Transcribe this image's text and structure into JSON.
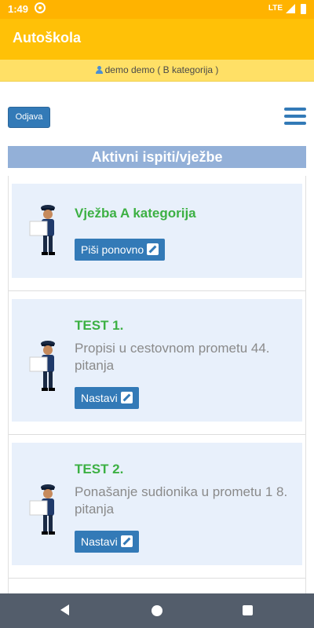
{
  "status_bar": {
    "time": "1:49",
    "network": "LTE",
    "icons": [
      "sync-icon",
      "signal-icon",
      "battery-icon"
    ]
  },
  "app": {
    "title": "Autoškola",
    "accent": "#ffc107"
  },
  "user": {
    "label": "demo demo ( B kategorija )",
    "icon": "user-icon"
  },
  "toolbar": {
    "logout_label": "Odjava",
    "menu_icon": "hamburger-menu-icon"
  },
  "section": {
    "title": "Aktivni ispiti/vježbe"
  },
  "exams": [
    {
      "title": "Vježba A kategorija",
      "subtitle": "",
      "button": "Piši ponovno",
      "button_icon": "edit-icon"
    },
    {
      "title": "TEST 1.",
      "subtitle": "Propisi u cestovnom prometu 44. pitanja",
      "button": "Nastavi",
      "button_icon": "edit-icon"
    },
    {
      "title": "TEST 2.",
      "subtitle": "Ponašanje sudionika u prometu 1 8. pitanja",
      "button": "Nastavi",
      "button_icon": "edit-icon"
    }
  ],
  "nav": {
    "icons": [
      "back-icon",
      "home-icon",
      "recent-apps-icon"
    ]
  }
}
